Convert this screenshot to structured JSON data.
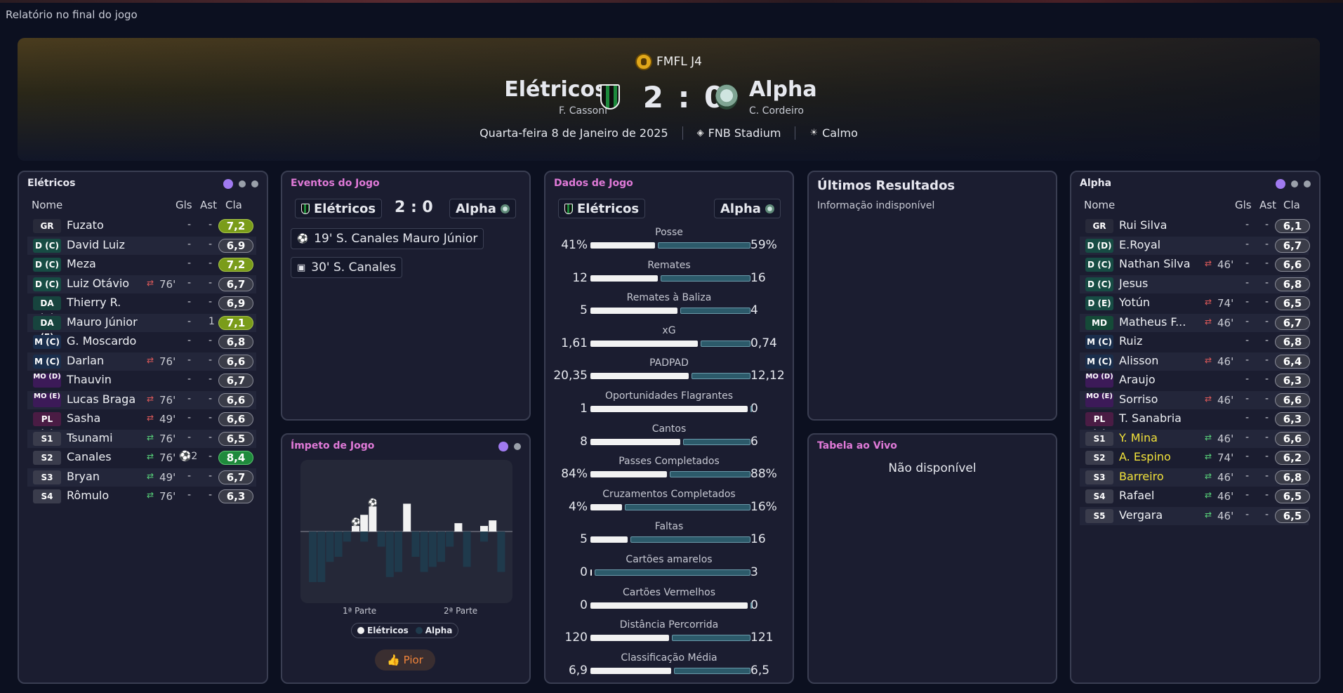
{
  "page_label": "Relatório no final do jogo",
  "header": {
    "competition": "FMFL J4",
    "home": {
      "name": "Elétricos",
      "coach": "F. Cassoni"
    },
    "away": {
      "name": "Alpha",
      "coach": "C. Cordeiro"
    },
    "score": "2 : 0",
    "date": "Quarta-feira 8 de Janeiro de 2025",
    "stadium": "FNB Stadium",
    "weather": "Calmo"
  },
  "columns": {
    "name": "Nome",
    "goals": "Gls",
    "assists": "Ast",
    "rating": "Cla"
  },
  "home_panel": {
    "title": "Elétricos",
    "players": [
      {
        "pos": "GR",
        "cls": "gk",
        "name": "Fuzato",
        "sub": "",
        "min": "",
        "gls": "-",
        "ast": "-",
        "rating": "7,2",
        "rc": "g1"
      },
      {
        "pos": "D (C)",
        "cls": "d",
        "name": "David Luiz",
        "sub": "",
        "min": "",
        "gls": "-",
        "ast": "-",
        "rating": "6,9",
        "rc": ""
      },
      {
        "pos": "D (C)",
        "cls": "d",
        "name": "Meza",
        "sub": "",
        "min": "",
        "gls": "-",
        "ast": "-",
        "rating": "7,2",
        "rc": "g1"
      },
      {
        "pos": "D (C)",
        "cls": "d",
        "name": "Luiz Otávio",
        "sub": "out",
        "min": "76'",
        "gls": "-",
        "ast": "-",
        "rating": "6,7",
        "rc": ""
      },
      {
        "pos": "DA (D)",
        "cls": "da",
        "name": "Thierry R.",
        "sub": "",
        "min": "",
        "gls": "-",
        "ast": "-",
        "rating": "6,9",
        "rc": ""
      },
      {
        "pos": "DA (E)",
        "cls": "da",
        "name": "Mauro Júnior",
        "sub": "",
        "min": "",
        "gls": "-",
        "ast": "1",
        "rating": "7,1",
        "rc": "g1"
      },
      {
        "pos": "M (C)",
        "cls": "m",
        "name": "G. Moscardo",
        "sub": "",
        "min": "",
        "gls": "-",
        "ast": "-",
        "rating": "6,8",
        "rc": ""
      },
      {
        "pos": "M (C)",
        "cls": "m",
        "name": "Darlan",
        "sub": "out",
        "min": "76'",
        "gls": "-",
        "ast": "-",
        "rating": "6,6",
        "rc": ""
      },
      {
        "pos": "MO (D)",
        "cls": "mo",
        "name": "Thauvin",
        "sub": "",
        "min": "",
        "gls": "-",
        "ast": "-",
        "rating": "6,7",
        "rc": ""
      },
      {
        "pos": "MO (E)",
        "cls": "mo",
        "name": "Lucas Braga",
        "sub": "out",
        "min": "76'",
        "gls": "-",
        "ast": "-",
        "rating": "6,6",
        "rc": ""
      },
      {
        "pos": "PL (C)",
        "cls": "pl",
        "name": "Sasha",
        "sub": "out",
        "min": "49'",
        "gls": "-",
        "ast": "-",
        "rating": "6,6",
        "rc": ""
      },
      {
        "pos": "S1",
        "cls": "s",
        "name": "Tsunami",
        "sub": "in",
        "min": "76'",
        "gls": "-",
        "ast": "-",
        "rating": "6,5",
        "rc": ""
      },
      {
        "pos": "S2",
        "cls": "s",
        "name": "Canales",
        "sub": "in",
        "min": "76'",
        "gls": "⚽2",
        "ast": "-",
        "rating": "8,4",
        "rc": "g2"
      },
      {
        "pos": "S3",
        "cls": "s",
        "name": "Bryan",
        "sub": "in",
        "min": "49'",
        "gls": "-",
        "ast": "-",
        "rating": "6,7",
        "rc": ""
      },
      {
        "pos": "S4",
        "cls": "s",
        "name": "Rômulo",
        "sub": "in",
        "min": "76'",
        "gls": "-",
        "ast": "-",
        "rating": "6,3",
        "rc": ""
      }
    ]
  },
  "away_panel": {
    "title": "Alpha",
    "players": [
      {
        "pos": "GR",
        "cls": "gk",
        "name": "Rui Silva",
        "sub": "",
        "min": "",
        "gls": "-",
        "ast": "-",
        "rating": "6,1",
        "rc": "",
        "yel": false
      },
      {
        "pos": "D (D)",
        "cls": "d",
        "name": "E.Royal",
        "sub": "",
        "min": "",
        "gls": "-",
        "ast": "-",
        "rating": "6,7",
        "rc": "",
        "yel": false
      },
      {
        "pos": "D (C)",
        "cls": "d",
        "name": "Nathan Silva",
        "sub": "out",
        "min": "46'",
        "gls": "-",
        "ast": "-",
        "rating": "6,6",
        "rc": "",
        "yel": false
      },
      {
        "pos": "D (C)",
        "cls": "d",
        "name": "Jesus",
        "sub": "",
        "min": "",
        "gls": "-",
        "ast": "-",
        "rating": "6,8",
        "rc": "",
        "yel": false
      },
      {
        "pos": "D (E)",
        "cls": "d",
        "name": "Yotún",
        "sub": "out",
        "min": "74'",
        "gls": "-",
        "ast": "-",
        "rating": "6,5",
        "rc": "",
        "yel": false
      },
      {
        "pos": "MD",
        "cls": "md",
        "name": "Matheus F...",
        "sub": "out",
        "min": "46'",
        "gls": "-",
        "ast": "-",
        "rating": "6,7",
        "rc": "",
        "yel": false
      },
      {
        "pos": "M (C)",
        "cls": "m",
        "name": "Ruiz",
        "sub": "",
        "min": "",
        "gls": "-",
        "ast": "-",
        "rating": "6,8",
        "rc": "",
        "yel": false
      },
      {
        "pos": "M (C)",
        "cls": "m",
        "name": "Alisson",
        "sub": "out",
        "min": "46'",
        "gls": "-",
        "ast": "-",
        "rating": "6,4",
        "rc": "",
        "yel": false
      },
      {
        "pos": "MO (D)",
        "cls": "mo",
        "name": "Araujo",
        "sub": "",
        "min": "",
        "gls": "-",
        "ast": "-",
        "rating": "6,3",
        "rc": "",
        "yel": false
      },
      {
        "pos": "MO (E)",
        "cls": "mo",
        "name": "Sorriso",
        "sub": "out",
        "min": "46'",
        "gls": "-",
        "ast": "-",
        "rating": "6,6",
        "rc": "",
        "yel": false
      },
      {
        "pos": "PL (C)",
        "cls": "pl",
        "name": "T. Sanabria",
        "sub": "",
        "min": "",
        "gls": "-",
        "ast": "-",
        "rating": "6,3",
        "rc": "",
        "yel": false
      },
      {
        "pos": "S1",
        "cls": "s",
        "name": "Y. Mina",
        "sub": "in",
        "min": "46'",
        "gls": "-",
        "ast": "-",
        "rating": "6,6",
        "rc": "",
        "yel": true
      },
      {
        "pos": "S2",
        "cls": "s",
        "name": "A. Espino",
        "sub": "in",
        "min": "74'",
        "gls": "-",
        "ast": "-",
        "rating": "6,2",
        "rc": "",
        "yel": true
      },
      {
        "pos": "S3",
        "cls": "s",
        "name": "Barreiro",
        "sub": "in",
        "min": "46'",
        "gls": "-",
        "ast": "-",
        "rating": "6,8",
        "rc": "",
        "yel": true
      },
      {
        "pos": "S4",
        "cls": "s",
        "name": "Rafael",
        "sub": "in",
        "min": "46'",
        "gls": "-",
        "ast": "-",
        "rating": "6,5",
        "rc": "",
        "yel": false
      },
      {
        "pos": "S5",
        "cls": "s",
        "name": "Vergara",
        "sub": "in",
        "min": "46'",
        "gls": "-",
        "ast": "-",
        "rating": "6,5",
        "rc": "",
        "yel": false
      }
    ]
  },
  "events_panel": {
    "title": "Eventos do Jogo",
    "home": "Elétricos",
    "away": "Alpha",
    "score": "2 : 0",
    "events": [
      {
        "icon": "⚽",
        "text": "19' S. Canales Mauro Júnior"
      },
      {
        "icon": "▣",
        "text": "30' S. Canales"
      }
    ]
  },
  "stats_panel": {
    "title": "Dados de Jogo",
    "home": "Elétricos",
    "away": "Alpha",
    "stats": [
      {
        "label": "Posse",
        "home": "41%",
        "away": "59%",
        "hv": 41,
        "av": 59
      },
      {
        "label": "Remates",
        "home": "12",
        "away": "16",
        "hv": 12,
        "av": 16
      },
      {
        "label": "Remates à Baliza",
        "home": "5",
        "away": "4",
        "hv": 5,
        "av": 4
      },
      {
        "label": "xG",
        "home": "1,61",
        "away": "0,74",
        "hv": 1.61,
        "av": 0.74
      },
      {
        "label": "PADPAD",
        "home": "20,35",
        "away": "12,12",
        "hv": 20.35,
        "av": 12.12
      },
      {
        "label": "Oportunidades Flagrantes",
        "home": "1",
        "away": "0",
        "hv": 1,
        "av": 0
      },
      {
        "label": "Cantos",
        "home": "8",
        "away": "6",
        "hv": 8,
        "av": 6
      },
      {
        "label": "Passes Completados",
        "home": "84%",
        "away": "88%",
        "hv": 84,
        "av": 88
      },
      {
        "label": "Cruzamentos Completados",
        "home": "4%",
        "away": "16%",
        "hv": 4,
        "av": 16
      },
      {
        "label": "Faltas",
        "home": "5",
        "away": "16",
        "hv": 5,
        "av": 16
      },
      {
        "label": "Cartões amarelos",
        "home": "0",
        "away": "3",
        "hv": 0,
        "av": 3
      },
      {
        "label": "Cartões Vermelhos",
        "home": "0",
        "away": "0",
        "hv": 0,
        "av": 0
      },
      {
        "label": "Distância Percorrida",
        "home": "120",
        "away": "121",
        "hv": 120,
        "av": 121
      },
      {
        "label": "Classificação Média",
        "home": "6,9",
        "away": "6,5",
        "hv": 6.9,
        "av": 6.5
      }
    ]
  },
  "results_panel": {
    "title": "Últimos Resultados",
    "body": "Informação indisponível"
  },
  "momentum_panel": {
    "title": "Ímpeto de Jogo",
    "first_half": "1ª Parte",
    "second_half": "2ª Parte",
    "legend_home": "Elétricos",
    "legend_away": "Alpha",
    "pior": "Pior",
    "colors": {
      "home": "#f2f2f2",
      "away": "#1f3a4c"
    }
  },
  "chart_data": {
    "type": "bar",
    "title": "Ímpeto de Jogo",
    "series": [
      {
        "name": "Elétricos",
        "values": [
          0,
          0,
          0,
          0,
          0,
          0.2,
          0.6,
          0.9,
          0,
          0,
          0,
          1,
          0,
          0,
          0,
          0,
          0,
          0.3,
          0,
          0,
          0.2,
          0.4,
          0,
          0
        ]
      },
      {
        "name": "Alpha",
        "values": [
          -1,
          -1,
          -0.6,
          -0.5,
          -0.2,
          0,
          -0.2,
          0,
          -0.3,
          -0.9,
          -0.8,
          0,
          -0.5,
          -0.8,
          -0.7,
          -0.6,
          -0.3,
          0,
          -0.7,
          0,
          -0.2,
          0,
          -0.8,
          0
        ]
      }
    ],
    "goals_at": [
      5,
      7
    ]
  },
  "live_table_panel": {
    "title": "Tabela ao Vivo",
    "body": "Não disponível"
  }
}
